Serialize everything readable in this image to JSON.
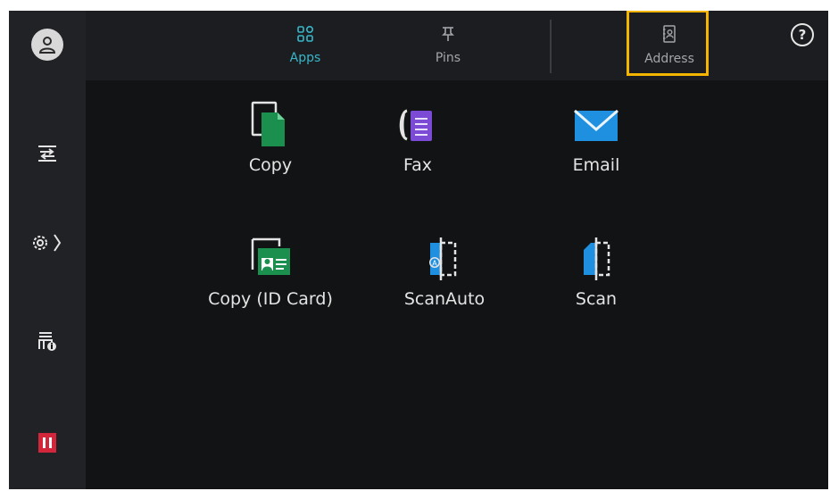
{
  "nav": {
    "tabs": [
      {
        "label": "Apps",
        "icon": "apps-grid-icon",
        "active": true
      },
      {
        "label": "Pins",
        "icon": "pin-icon",
        "active": false
      },
      {
        "label": "Address",
        "icon": "address-book-icon",
        "active": false
      }
    ],
    "help_symbol": "?"
  },
  "sidebar": {
    "items": [
      {
        "icon": "user-icon"
      },
      {
        "icon": "job-flow-icon"
      },
      {
        "icon": "settings-icon"
      },
      {
        "icon": "printer-info-icon"
      },
      {
        "icon": "pause-icon"
      }
    ]
  },
  "apps": [
    {
      "label": "Copy",
      "icon": "copy-icon"
    },
    {
      "label": "Fax",
      "icon": "fax-icon"
    },
    {
      "label": "Email",
      "icon": "email-icon"
    },
    {
      "label": "Copy (ID Card)",
      "icon": "id-card-copy-icon"
    },
    {
      "label": "ScanAuto",
      "icon": "scan-auto-icon"
    },
    {
      "label": "Scan",
      "icon": "scan-icon"
    }
  ],
  "colors": {
    "accent": "#38b7c9",
    "highlight": "#f4b500",
    "pause": "#d3263b",
    "copy_green": "#1a8f4e",
    "fax_purple": "#7b4bd6",
    "email_blue": "#1f8fe0"
  }
}
